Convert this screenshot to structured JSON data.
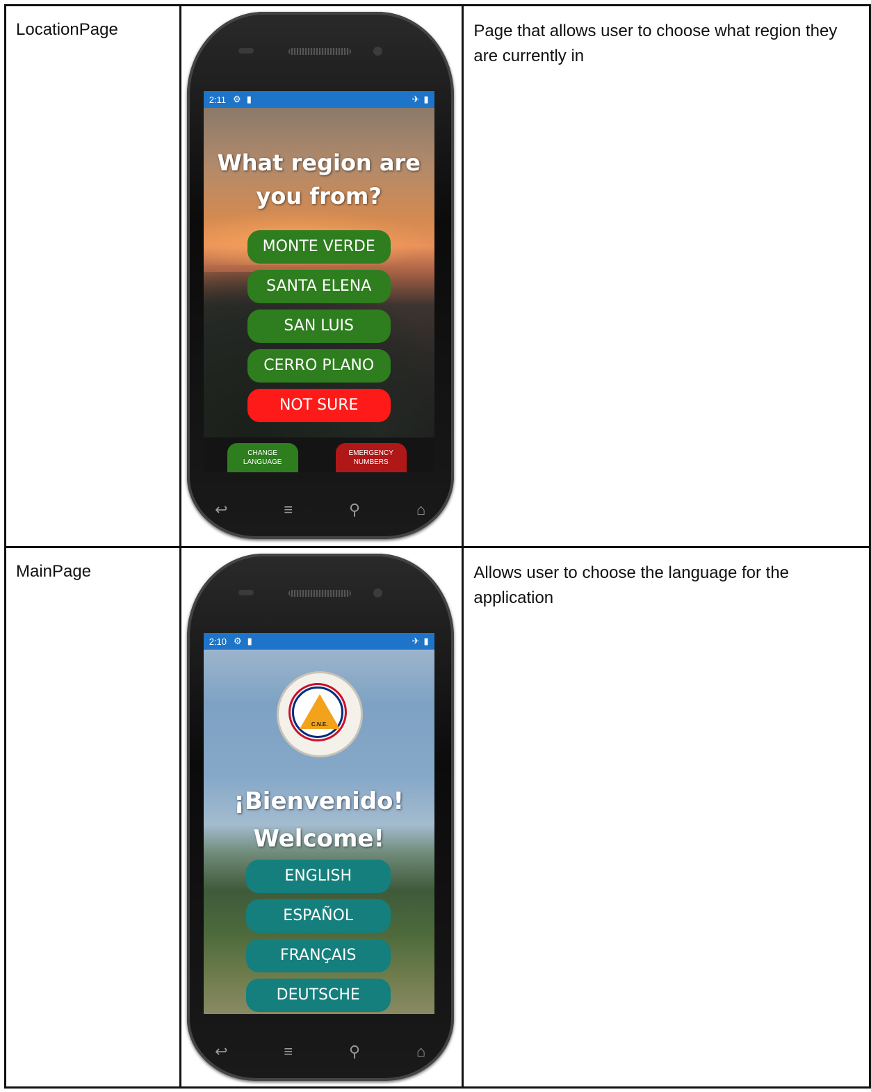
{
  "rows": [
    {
      "label": "LocationPage",
      "description": "Page that allows user to choose what region they are currently in",
      "status": {
        "time": "2:11"
      },
      "heading_line1": "What region are",
      "heading_line2": "you from?",
      "buttons": [
        "MONTE VERDE",
        "SANTA ELENA",
        "SAN LUIS",
        "CERRO PLANO",
        "NOT SURE"
      ],
      "footer": {
        "left_line1": "CHANGE",
        "left_line2": "LANGUAGE",
        "right_line1": "EMERGENCY",
        "right_line2": "NUMBERS"
      }
    },
    {
      "label": "MainPage",
      "description": "Allows user to choose the language for the application",
      "status": {
        "time": "2:10"
      },
      "logo_text": "C.N.E.",
      "heading_line1": "¡Bienvenido!",
      "heading_line2": "Welcome!",
      "buttons": [
        "ENGLISH",
        "ESPAÑOL",
        "FRANÇAIS",
        "DEUTSCHE"
      ]
    }
  ],
  "colors": {
    "status_bar": "#1e74c8",
    "green_button": "#2e7d1e",
    "red_button": "#ff1a1a",
    "teal_button": "#147f7c"
  },
  "icons": [
    "gear-icon",
    "sd-card-icon",
    "airplane-icon",
    "battery-icon",
    "back-icon",
    "menu-icon",
    "search-icon",
    "home-icon"
  ]
}
